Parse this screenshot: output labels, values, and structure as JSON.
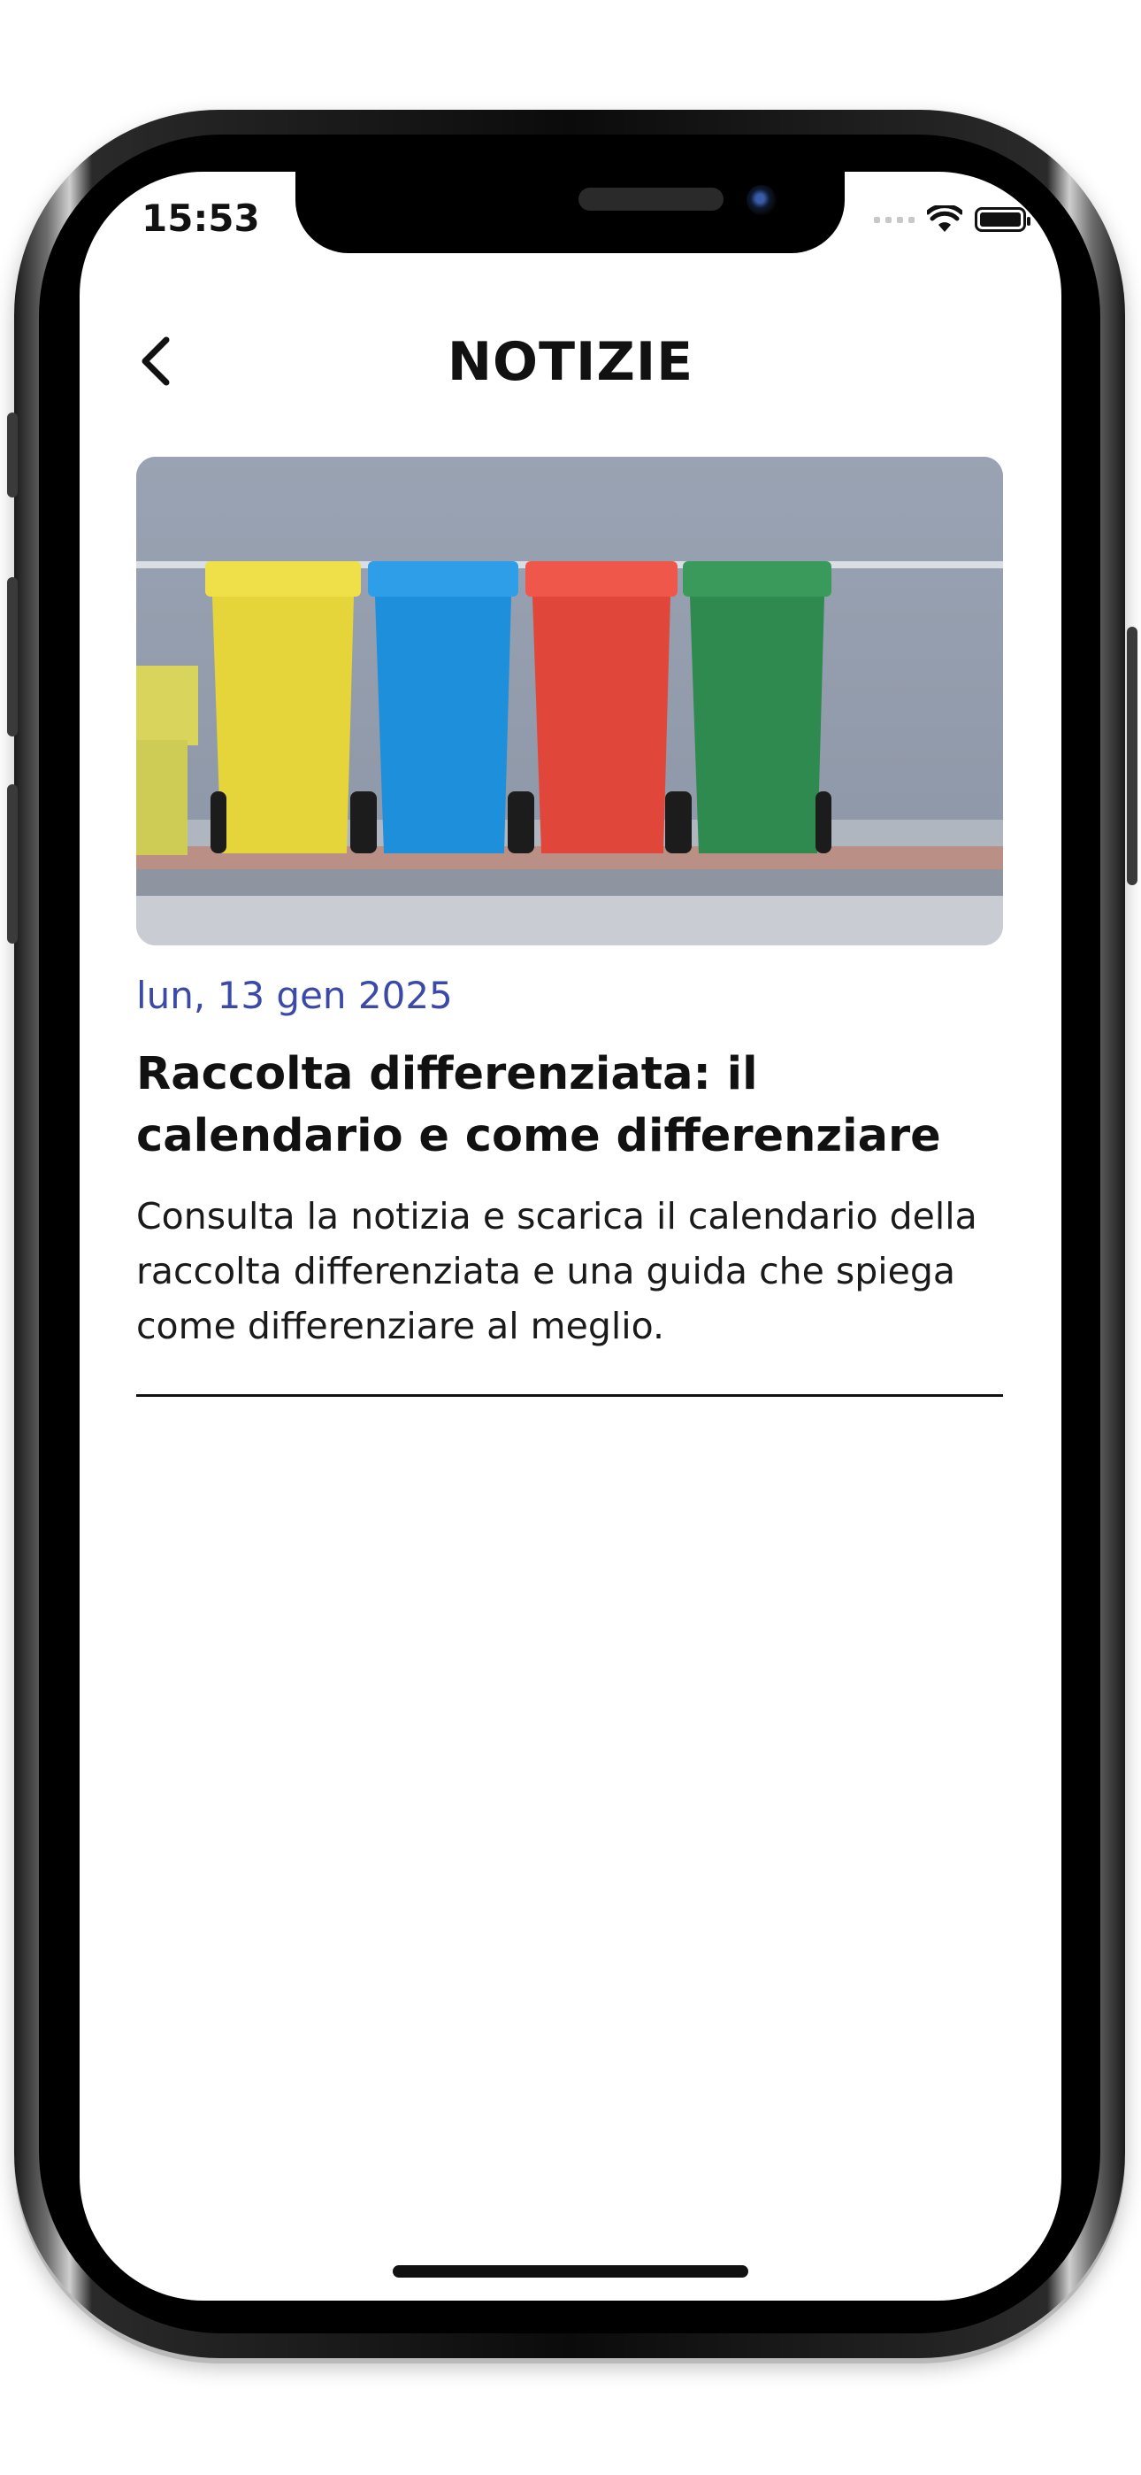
{
  "status_bar": {
    "time": "15:53"
  },
  "nav": {
    "title": "NOTIZIE"
  },
  "news": [
    {
      "image": "recycling-bins-photo",
      "date": "lun, 13 gen 2025",
      "title": "Raccolta differenziata: il calendario e come differenziare",
      "summary": "Consulta la notizia e scarica il calendario della raccolta differenziata e una guida che spiega come differenziare al meglio."
    }
  ],
  "colors": {
    "date": "#3b49a8",
    "text": "#111111",
    "bin_yellow": "#e6d53a",
    "bin_blue": "#1e8fdb",
    "bin_red": "#e0473a",
    "bin_green": "#2e8a4f"
  }
}
